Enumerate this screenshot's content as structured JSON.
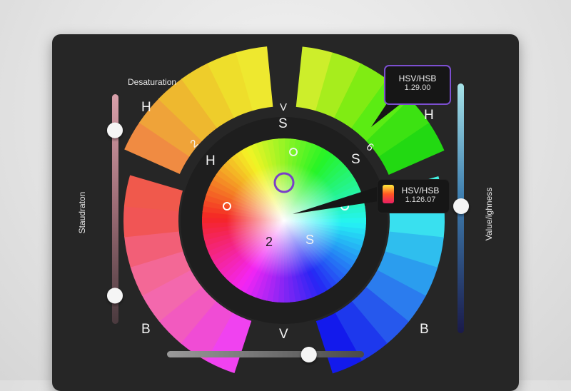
{
  "labels": {
    "desaturation": "Desaturation",
    "saturation_vertical": "Staudraton",
    "value_vertical": "Value/ighness",
    "h_top_left": "H",
    "v_top": "V",
    "s_top": "S",
    "h_right": "H",
    "num_2_ring": "2",
    "h_inner_left": "H",
    "s_inner_right": "S",
    "num_6_ring": "6",
    "b_left": "B",
    "b_right": "B",
    "v_bottom": "V",
    "wheel_2": "2",
    "wheel_s": "S"
  },
  "tooltip_top": {
    "title": "HSV/HSB",
    "value": "1.29.00"
  },
  "tooltip_mid": {
    "title": "HSV/HSB",
    "value": "1.126.07"
  },
  "sliders": {
    "saturation_left": {
      "upper_handle": 0.12,
      "lower_handle": 0.88
    },
    "value_right": {
      "handle": 0.5
    },
    "value_bottom": {
      "handle": 0.72
    }
  },
  "colors": {
    "panel": "#262626",
    "tooltip_border": "#7c4fd0"
  }
}
